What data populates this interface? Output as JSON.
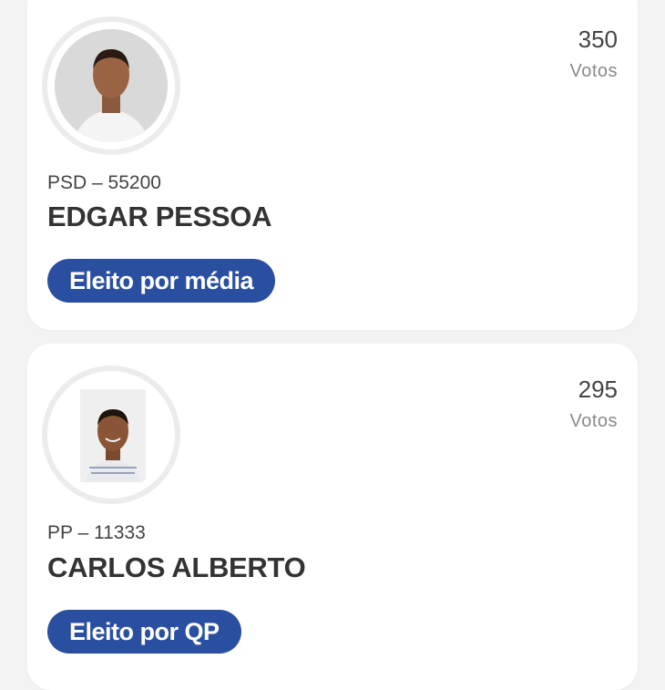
{
  "candidates": [
    {
      "party_number": "PSD – 55200",
      "name": "EDGAR PESSOA",
      "votes": "350",
      "votes_label": "Votos",
      "status": "Eleito por média",
      "avatar": "candidate-photo"
    },
    {
      "party_number": "PP – 11333",
      "name": "CARLOS ALBERTO",
      "votes": "295",
      "votes_label": "Votos",
      "status": "Eleito por QP",
      "avatar": "candidate-photo"
    }
  ],
  "colors": {
    "badge": "#2b4fa0",
    "card": "#ffffff",
    "background": "#f3f3f3"
  }
}
